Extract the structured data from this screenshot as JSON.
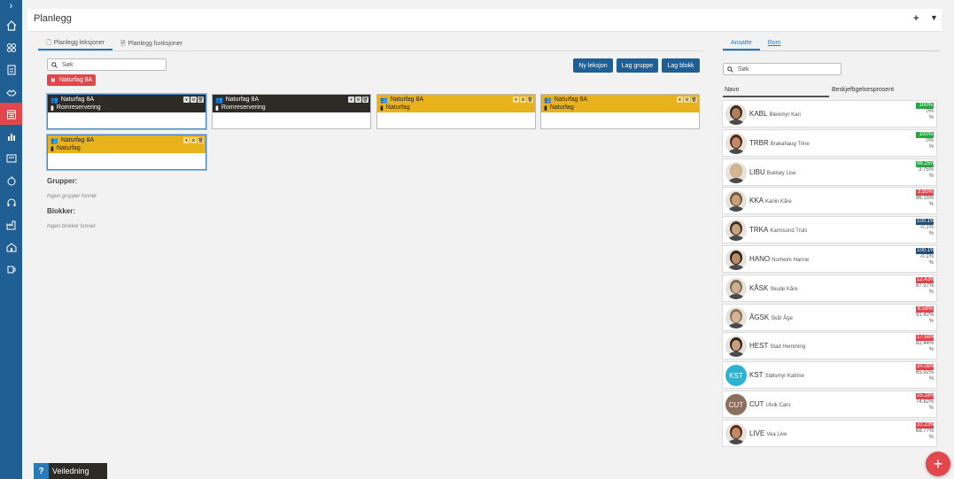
{
  "header": {
    "title": "Planlegg",
    "plus_icon": "plus-icon",
    "filter_icon": "filter-icon"
  },
  "sidebar": {
    "items": [
      {
        "icon": "home-icon"
      },
      {
        "icon": "groups-icon"
      },
      {
        "icon": "id-card-icon"
      },
      {
        "icon": "handshake-icon"
      },
      {
        "icon": "calendar-icon",
        "active": true
      },
      {
        "icon": "bar-chart-icon"
      },
      {
        "icon": "card-icon"
      },
      {
        "icon": "apple-icon"
      },
      {
        "icon": "headset-icon"
      },
      {
        "icon": "factory-icon"
      },
      {
        "icon": "school-icon"
      },
      {
        "icon": "coffee-icon"
      }
    ]
  },
  "main": {
    "tabs": [
      {
        "label": "Planlegg leksjoner",
        "icon": "file-icon",
        "active": true
      },
      {
        "label": "Planlegg funksjoner",
        "icon": "file-text-icon",
        "active": false
      }
    ],
    "search": {
      "placeholder": "Søk"
    },
    "chip": {
      "label": "Naturfag 8A"
    },
    "buttons": {
      "new_lesson": "Ny leksjon",
      "new_group": "Lag gruppe",
      "new_block": "Lag blokk"
    },
    "cards": [
      {
        "title": "Naturfag 8A",
        "subtitle": "Romreservering",
        "style": "dark",
        "selected": true
      },
      {
        "title": "Naturfag 8A",
        "subtitle": "Romreservering",
        "style": "dark",
        "selected": false
      },
      {
        "title": "Naturfag 8A",
        "subtitle": "Naturfag",
        "style": "gold",
        "selected": false
      },
      {
        "title": "Naturfag 8A",
        "subtitle": "Naturfag",
        "style": "gold",
        "selected": false
      },
      {
        "title": "Naturfag 8A",
        "subtitle": "Naturfag",
        "style": "gold",
        "selected": true
      }
    ],
    "groups_label": "Grupper:",
    "groups_empty": "Ingen grupper funnet",
    "blocks_label": "Blokker:",
    "blocks_empty": "Ingen blokker funnet"
  },
  "right": {
    "tabs": [
      {
        "label": "Ansatte",
        "active": true
      },
      {
        "label": "Rom",
        "active": false
      }
    ],
    "search": {
      "placeholder": "Søk"
    },
    "col_name": "Navn",
    "col_pct": "Beskjeftigelsesprosent",
    "people": [
      {
        "code": "KABL",
        "name": "Bleikmyr Kari",
        "badge": "100%",
        "rest": "0%",
        "unit": "%",
        "color": "#28a745",
        "avatar": "photo",
        "skin": "#b07f5b",
        "hair": "#3a2616"
      },
      {
        "code": "TRBR",
        "name": "Brakahaug Trine",
        "badge": "100%",
        "rest": "0%",
        "unit": "%",
        "color": "#28a745",
        "avatar": "photo",
        "skin": "#c08a6a",
        "hair": "#4a2414"
      },
      {
        "code": "LIBU",
        "name": "Bukkøy Lise",
        "badge": "96.25%",
        "rest": "3.75%",
        "unit": "%",
        "color": "#28a745",
        "avatar": "photo",
        "skin": "#d8b596",
        "hair": "#c9b089"
      },
      {
        "code": "KKA",
        "name": "Kanin Kåre",
        "badge": "3.85%",
        "rest": "96.15%",
        "unit": "%",
        "color": "#e3474e",
        "avatar": "photo",
        "skin": "#c9a07a",
        "hair": "#6b5a3c"
      },
      {
        "code": "TRKA",
        "name": "Karmsund Truls",
        "badge": "100.1%",
        "rest": "-0.1%",
        "unit": "%",
        "color": "#1f4e79",
        "avatar": "photo",
        "skin": "#caa182",
        "hair": "#3e3020"
      },
      {
        "code": "HANO",
        "name": "Norheim Hanne",
        "badge": "100.1%",
        "rest": "-0.1%",
        "unit": "%",
        "color": "#1f4e79",
        "avatar": "photo",
        "skin": "#b98a67",
        "hair": "#2e1f14"
      },
      {
        "code": "KÅSK",
        "name": "Skude Kåre",
        "badge": "12.43%",
        "rest": "87.57%",
        "unit": "%",
        "color": "#e3474e",
        "avatar": "photo",
        "skin": "#cfb093",
        "hair": "#7c6a50"
      },
      {
        "code": "ÅGSK",
        "name": "Skår Åge",
        "badge": "8.58%",
        "rest": "91.42%",
        "unit": "%",
        "color": "#e3474e",
        "avatar": "photo",
        "skin": "#d5b497",
        "hair": "#8a7458"
      },
      {
        "code": "HEST",
        "name": "Stad Hemming",
        "badge": "17.56%",
        "rest": "82.44%",
        "unit": "%",
        "color": "#e3474e",
        "avatar": "photo",
        "skin": "#c79e82",
        "hair": "#2b2018"
      },
      {
        "code": "KST",
        "name": "Stølsmyr Katrine",
        "badge": "34.08%",
        "rest": "65.92%",
        "unit": "%",
        "color": "#e3474e",
        "avatar": "initials",
        "initials": "KST",
        "bg": "#2bb3d3"
      },
      {
        "code": "CUT",
        "name": "Utvik Caro",
        "badge": "25.18%",
        "rest": "74.82%",
        "unit": "%",
        "color": "#e3474e",
        "avatar": "initials",
        "initials": "CUT",
        "bg": "#8c6f5d"
      },
      {
        "code": "LIVE",
        "name": "Vea Live",
        "badge": "31.23%",
        "rest": "68.77%",
        "unit": "%",
        "color": "#e3474e",
        "avatar": "photo",
        "skin": "#c08a6a",
        "hair": "#5a2a18"
      }
    ]
  },
  "help": {
    "label": "Veiledning",
    "q": "?"
  },
  "fab": {
    "label": "+"
  }
}
